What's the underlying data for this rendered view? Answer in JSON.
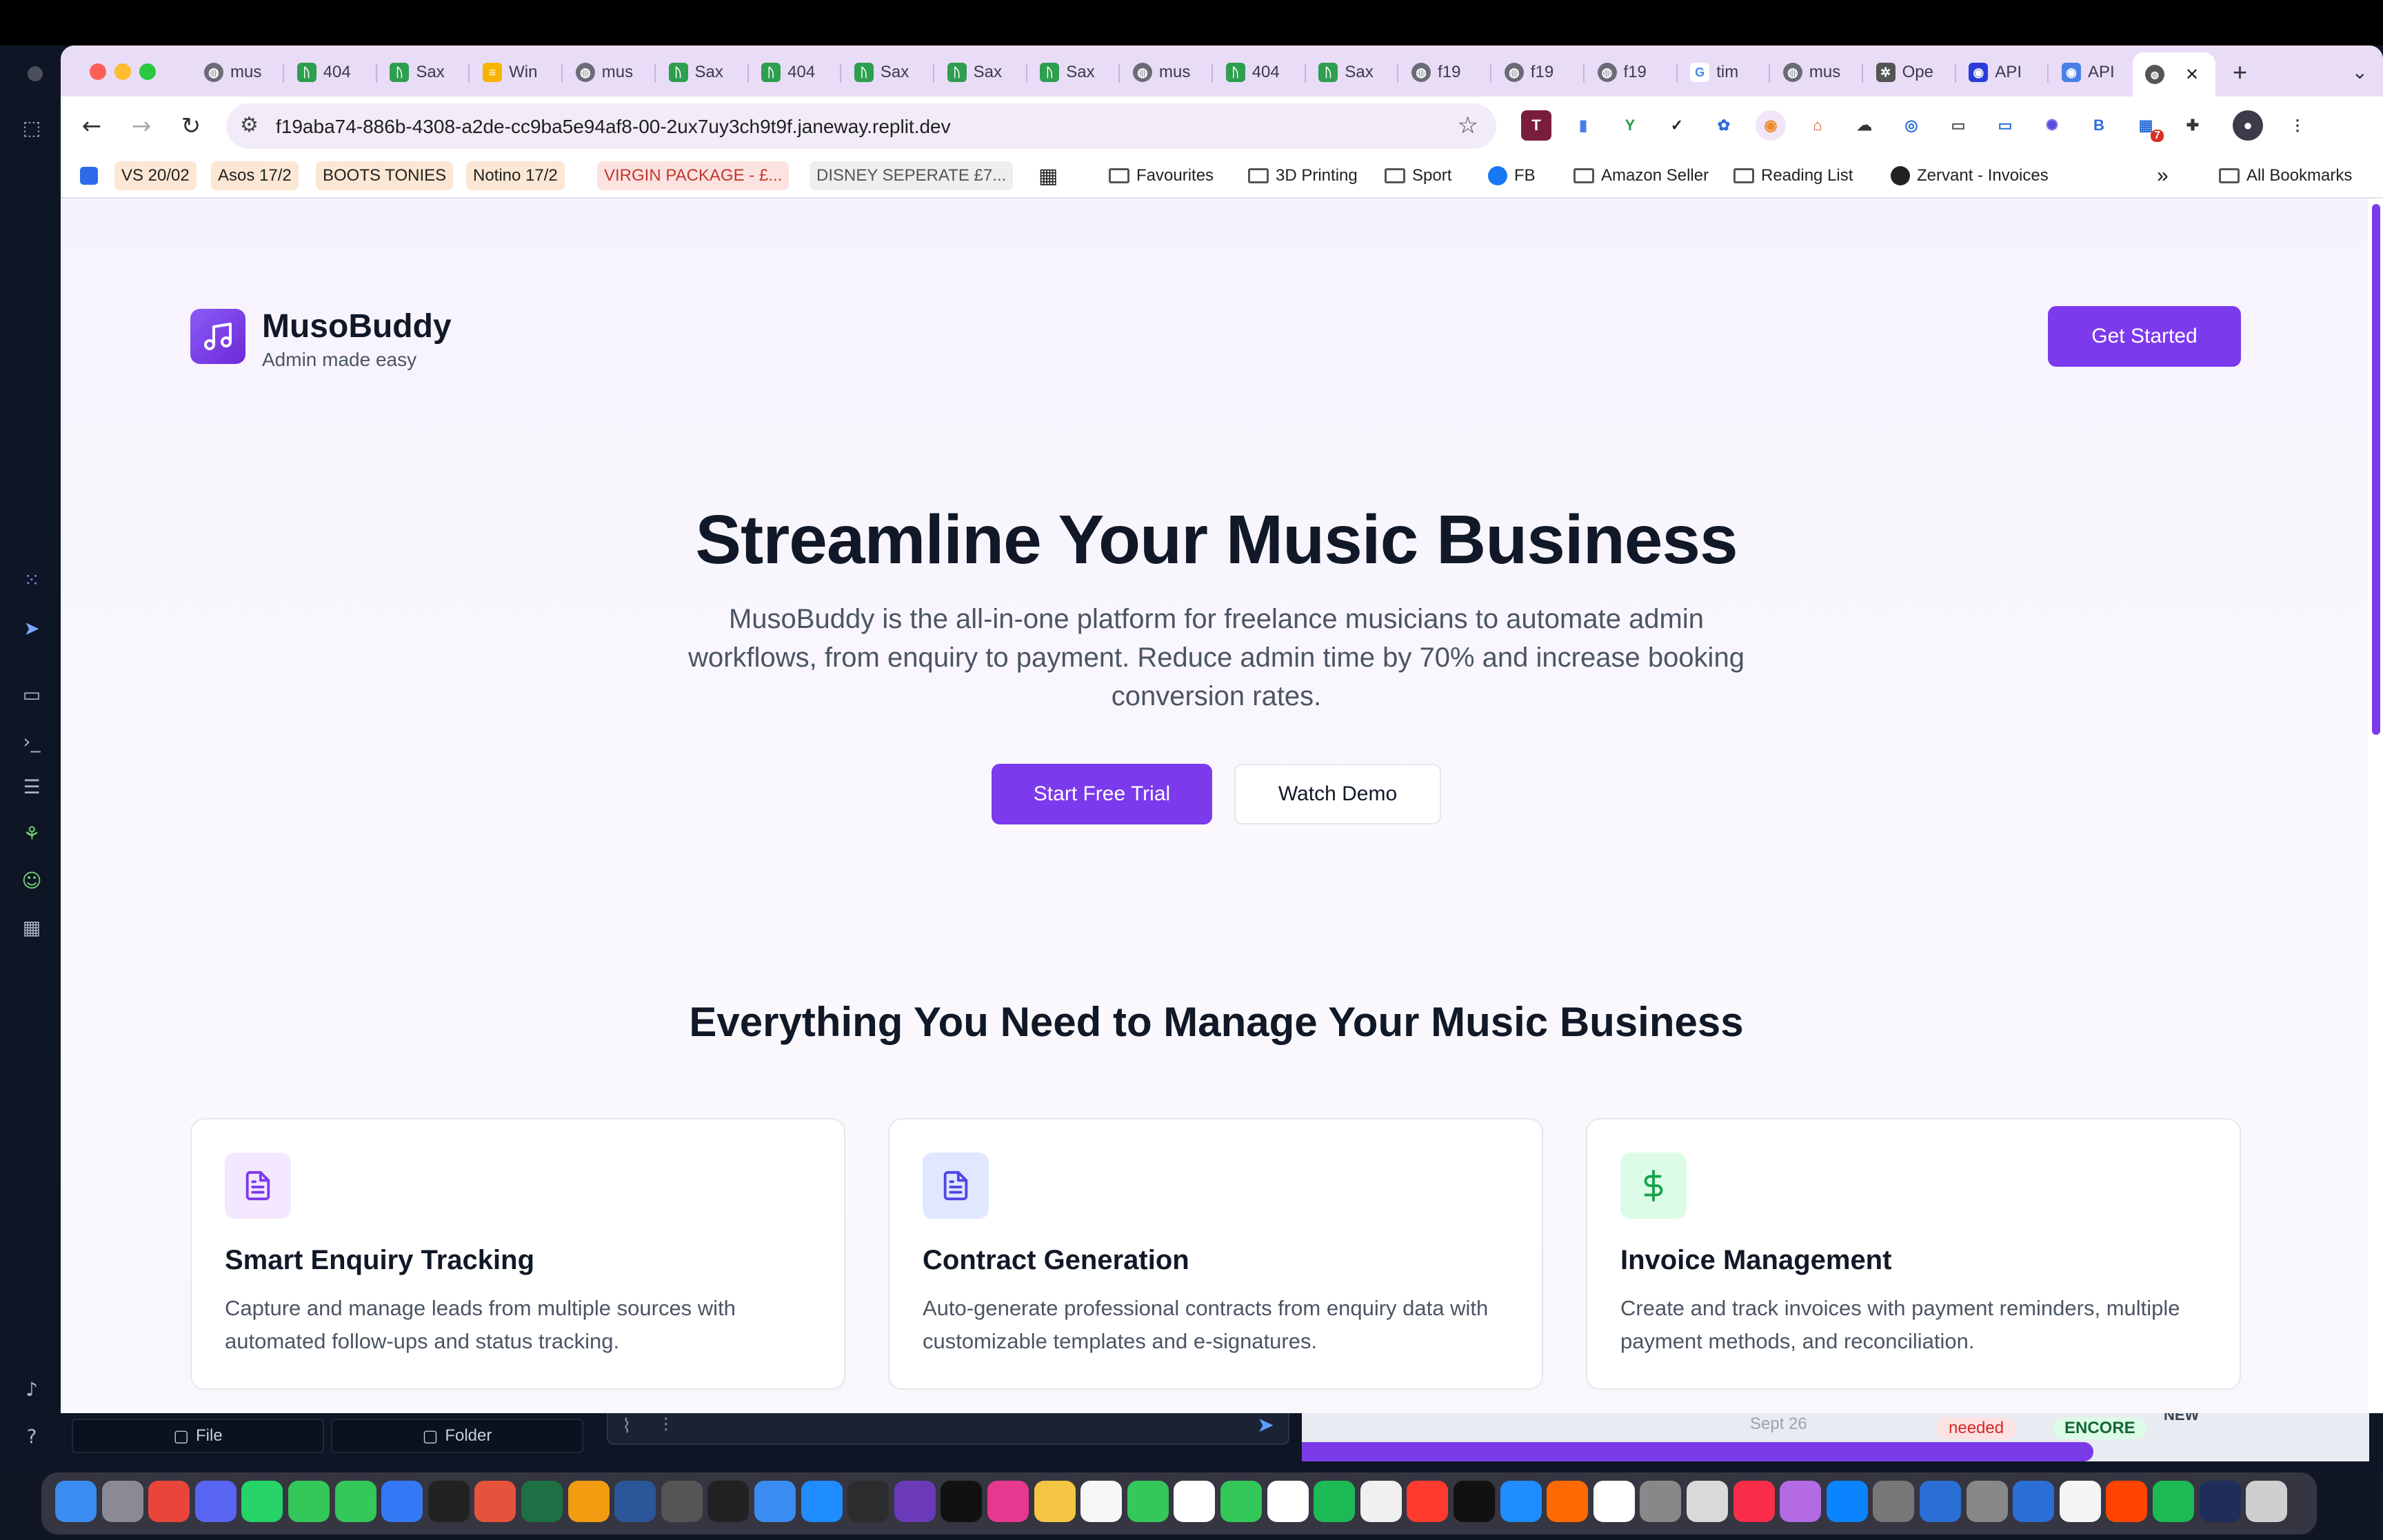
{
  "browser": {
    "tabs": [
      {
        "label": "mus",
        "fav": "globe"
      },
      {
        "label": "404",
        "fav": "green"
      },
      {
        "label": "Sax",
        "fav": "green"
      },
      {
        "label": "Win",
        "fav": "yellow"
      },
      {
        "label": "mus",
        "fav": "globe"
      },
      {
        "label": "Sax",
        "fav": "green"
      },
      {
        "label": "404",
        "fav": "green"
      },
      {
        "label": "Sax",
        "fav": "green"
      },
      {
        "label": "Sax",
        "fav": "green"
      },
      {
        "label": "Sax",
        "fav": "green"
      },
      {
        "label": "mus",
        "fav": "globe"
      },
      {
        "label": "404",
        "fav": "green"
      },
      {
        "label": "Sax",
        "fav": "green"
      },
      {
        "label": "f19",
        "fav": "globe"
      },
      {
        "label": "f19",
        "fav": "globe"
      },
      {
        "label": "f19",
        "fav": "globe"
      },
      {
        "label": "tim",
        "fav": "google"
      },
      {
        "label": "mus",
        "fav": "globe"
      },
      {
        "label": "Ope",
        "fav": "openai"
      },
      {
        "label": "API",
        "fav": "blue"
      },
      {
        "label": "API",
        "fav": "blue2"
      }
    ],
    "active_tab_close": "✕",
    "new_tab": "+",
    "url": "f19aba74-886b-4308-a2de-cc9ba5e94af8-00-2ux7uy3ch9t9f.janeway.replit.dev",
    "ext_badge": "7",
    "bookmarks": [
      {
        "label": "VS 20/02",
        "bg": "#fbe7d3"
      },
      {
        "label": "Asos 17/2",
        "bg": "#fbe7d3"
      },
      {
        "label": "BOOTS TONIES",
        "bg": "#fbe7d3"
      },
      {
        "label": "Notino 17/2",
        "bg": "#fbe7d3"
      },
      {
        "label": "VIRGIN PACKAGE - £...",
        "bg": "#fde2e2"
      },
      {
        "label": "DISNEY SEPERATE £7...",
        "bg": "#eeeeee"
      }
    ],
    "bookmark_folders": [
      "Favourites",
      "3D Printing",
      "Sport",
      "FB",
      "Amazon Seller",
      "Reading List",
      "Zervant - Invoices"
    ],
    "all_bookmarks": "All Bookmarks"
  },
  "header": {
    "brand": "MusoBuddy",
    "tagline": "Admin made easy",
    "cta": "Get Started"
  },
  "hero": {
    "title": "Streamline Your Music Business",
    "subtitle": "MusoBuddy is the all-in-one platform for freelance musicians to automate admin workflows, from enquiry to payment. Reduce admin time by 70% and increase booking conversion rates.",
    "primary_button": "Start Free Trial",
    "secondary_button": "Watch Demo"
  },
  "features": {
    "title": "Everything You Need to Manage Your Music Business",
    "cards": [
      {
        "icon": "document-icon",
        "title": "Smart Enquiry Tracking",
        "desc": "Capture and manage leads from multiple sources with automated follow-ups and status tracking.",
        "icon_bg": "#f3e8ff",
        "icon_color": "#7c3aed"
      },
      {
        "icon": "document-icon",
        "title": "Contract Generation",
        "desc": "Auto-generate professional contracts from enquiry data with customizable templates and e-signatures.",
        "icon_bg": "#e0e7ff",
        "icon_color": "#4f46e5"
      },
      {
        "icon": "dollar-icon",
        "title": "Invoice Management",
        "desc": "Create and track invoices with payment reminders, multiple payment methods, and reconciliation.",
        "icon_bg": "#dcfce7",
        "icon_color": "#16a34a"
      }
    ]
  },
  "ide": {
    "file_tab": "File",
    "folder_tab": "Folder",
    "preview_date": "Sept 26",
    "preview_needed": "needed",
    "preview_encore": "ENCORE",
    "preview_new": "NEW"
  },
  "colors": {
    "accent": "#7c3aed",
    "tabstrip": "#e8dcf7"
  }
}
